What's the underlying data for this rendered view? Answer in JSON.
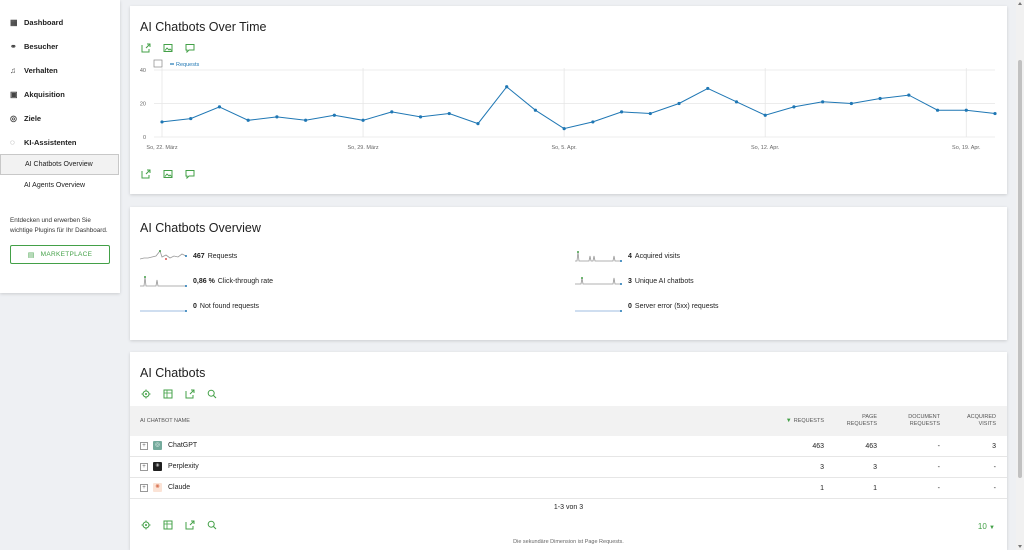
{
  "sidebar": {
    "items": [
      {
        "label": "Dashboard",
        "icon": "dashboard-icon"
      },
      {
        "label": "Besucher",
        "icon": "visitors-icon"
      },
      {
        "label": "Verhalten",
        "icon": "bell-icon"
      },
      {
        "label": "Akquisition",
        "icon": "acquisition-icon"
      },
      {
        "label": "Ziele",
        "icon": "goal-icon"
      },
      {
        "label": "KI-Assistenten",
        "icon": "chat-icon"
      }
    ],
    "subitems": [
      {
        "label": "AI Chatbots Overview",
        "active": true
      },
      {
        "label": "AI Agents Overview",
        "active": false
      }
    ],
    "plugins_text": "Entdecken und erwerben Sie wichtige Plugins für Ihr Dashboard.",
    "marketplace_label": "MARKETPLACE"
  },
  "evolution": {
    "title": "AI Chatbots Over Time"
  },
  "chart_data": {
    "type": "line",
    "title": "AI Chatbots Over Time",
    "series": [
      {
        "name": "Requests",
        "color": "#1f77b4",
        "values": [
          9,
          11,
          18,
          10,
          12,
          10,
          13,
          10,
          15,
          12,
          14,
          8,
          30,
          16,
          5,
          9,
          15,
          14,
          20,
          29,
          21,
          13,
          18,
          21,
          20,
          23,
          25,
          16,
          16,
          14
        ]
      }
    ],
    "x": [
      "2025-03-22",
      "2025-03-23",
      "2025-03-24",
      "2025-03-25",
      "2025-03-26",
      "2025-03-27",
      "2025-03-28",
      "2025-03-29",
      "2025-03-30",
      "2025-03-31",
      "2025-04-01",
      "2025-04-02",
      "2025-04-03",
      "2025-04-04",
      "2025-04-05",
      "2025-04-06",
      "2025-04-07",
      "2025-04-08",
      "2025-04-09",
      "2025-04-10",
      "2025-04-11",
      "2025-04-12",
      "2025-04-13",
      "2025-04-14",
      "2025-04-15",
      "2025-04-16",
      "2025-04-17",
      "2025-04-18",
      "2025-04-19",
      "2025-04-20"
    ],
    "x_tick_labels": [
      "So, 22. März",
      "So, 29. März",
      "So, 5. Apr.",
      "So, 12. Apr.",
      "So, 19. Apr."
    ],
    "y_ticks": [
      0,
      20,
      40
    ],
    "ylim": [
      0,
      40
    ],
    "grid": true,
    "legend": "top-left"
  },
  "overview": {
    "title": "AI Chatbots Overview",
    "left": [
      {
        "value": "467",
        "label": "Requests"
      },
      {
        "value": "0,86 %",
        "label": "Click-through rate"
      },
      {
        "value": "0",
        "label": "Not found requests"
      }
    ],
    "right": [
      {
        "value": "4",
        "label": "Acquired visits"
      },
      {
        "value": "3",
        "label": "Unique AI chatbots"
      },
      {
        "value": "0",
        "label": "Server error (5xx) requests"
      }
    ]
  },
  "table": {
    "title": "AI Chatbots",
    "columns": {
      "name": "AI CHATBOT NAME",
      "requests": "REQUESTS",
      "page_requests_1": "PAGE",
      "page_requests_2": "REQUESTS",
      "document_requests_1": "DOCUMENT",
      "document_requests_2": "REQUESTS",
      "acquired_visits_1": "ACQUIRED",
      "acquired_visits_2": "VISITS"
    },
    "rows": [
      {
        "name": "ChatGPT",
        "requests": "463",
        "page_requests": "463",
        "document_requests": "-",
        "acquired_visits": "3"
      },
      {
        "name": "Perplexity",
        "requests": "3",
        "page_requests": "3",
        "document_requests": "-",
        "acquired_visits": "-"
      },
      {
        "name": "Claude",
        "requests": "1",
        "page_requests": "1",
        "document_requests": "-",
        "acquired_visits": "-"
      }
    ],
    "pagination": "1-3 von 3",
    "limit": "10",
    "footnote": "Die sekundäre Dimension ist Page Requests."
  },
  "colors": {
    "accent": "#43a047",
    "series": "#1f77b4"
  }
}
